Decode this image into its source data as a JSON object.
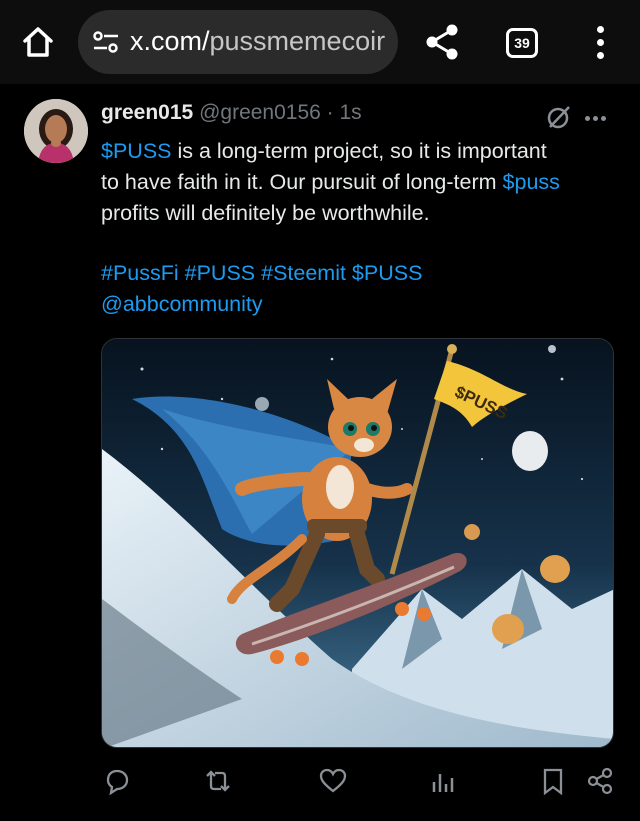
{
  "browser": {
    "url_host": "x.com/",
    "url_path": "pussmemecoir",
    "tab_count": "39",
    "icons": [
      "home-icon",
      "site-settings-icon",
      "share-icon",
      "tabs-icon",
      "menu-icon"
    ]
  },
  "post": {
    "display_name": "green015",
    "handle": "@green0156",
    "separator": " · ",
    "time": "1s",
    "body": {
      "l1_cashtag": "$PUSS",
      "l1_text": " is a long-term project, so it is important",
      "l2_text": "to have faith in it. Our pursuit of long-term ",
      "l2_cashtag": "$puss",
      "l3_text": "profits will definitely be worthwhile."
    },
    "tags": {
      "line1": "#PussFi #PUSS #Steemit $PUSS",
      "line2": "@abbcommunity"
    },
    "media": {
      "flag_text": "$PUSS",
      "subject": "cat-superhero-skateboard"
    }
  },
  "actions": [
    "reply-icon",
    "repost-icon",
    "like-icon",
    "views-icon",
    "bookmark-icon",
    "share-icon"
  ],
  "colors": {
    "background": "#000000",
    "link": "#1d9bf0",
    "text": "#e7e9ea",
    "muted": "#71767b",
    "urlbar": "#2b2b2b"
  }
}
